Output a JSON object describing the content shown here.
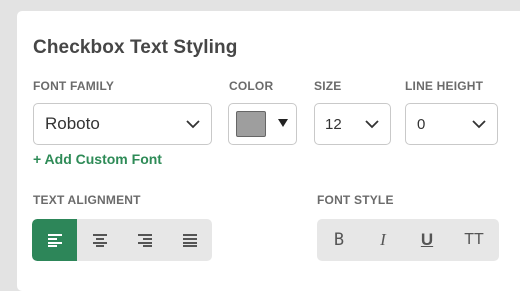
{
  "panel": {
    "title": "Checkbox Text Styling"
  },
  "font_family": {
    "label": "FONT FAMILY",
    "value": "Roboto",
    "add_custom_label": "+ Add Custom Font"
  },
  "color": {
    "label": "COLOR",
    "swatch_hex": "#9e9e9e"
  },
  "size": {
    "label": "SIZE",
    "value": "12"
  },
  "line_height": {
    "label": "LINE HEIGHT",
    "value": "0"
  },
  "text_alignment": {
    "label": "TEXT ALIGNMENT",
    "buttons": [
      {
        "icon": "align-left-icon",
        "active": true
      },
      {
        "icon": "align-center-icon",
        "active": false
      },
      {
        "icon": "align-right-icon",
        "active": false
      },
      {
        "icon": "align-justify-icon",
        "active": false
      }
    ]
  },
  "font_style": {
    "label": "FONT STYLE",
    "bold": "B",
    "italic": "I",
    "underline": "U",
    "uppercase": "TT"
  },
  "colors": {
    "accent": "#2d8659",
    "link": "#2e8b57"
  }
}
